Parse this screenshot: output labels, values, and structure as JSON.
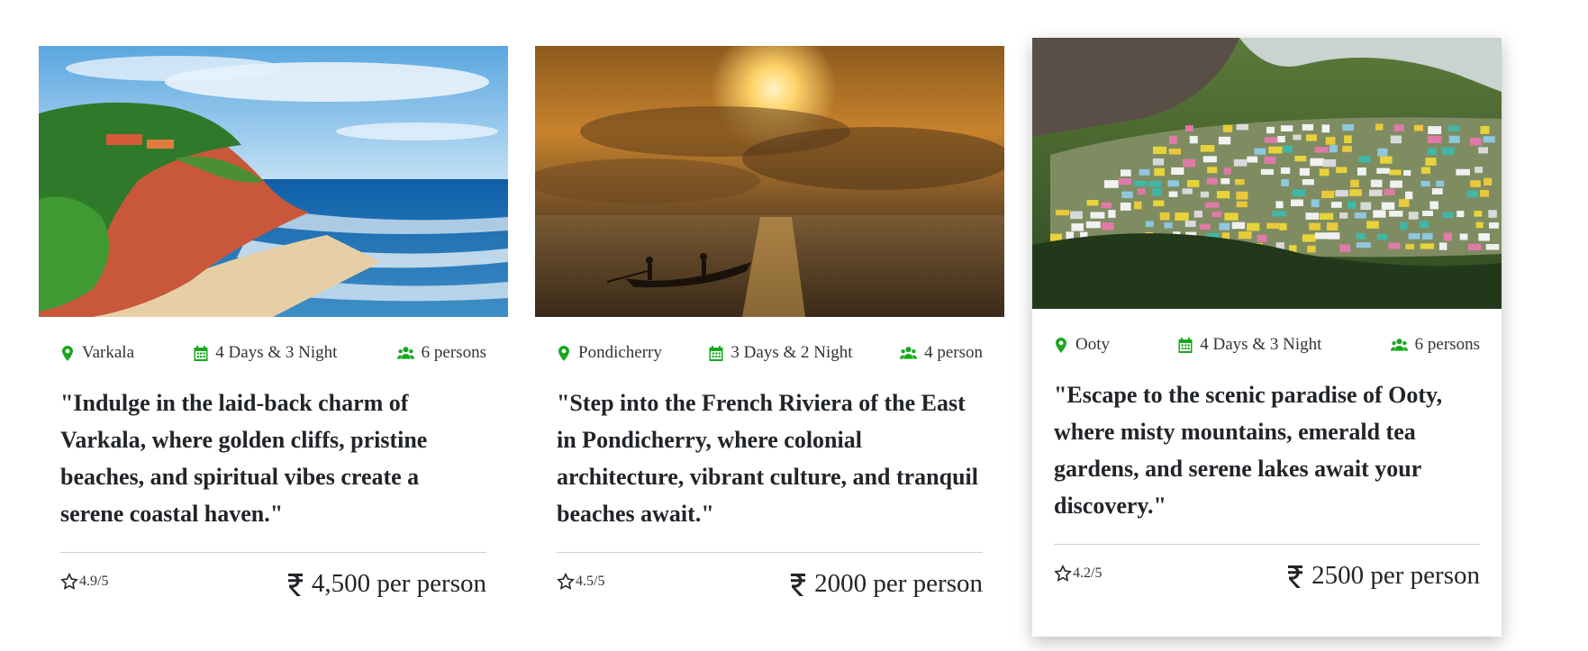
{
  "cards": [
    {
      "location": "Varkala",
      "duration": "4 Days & 3 Night",
      "persons": "6 persons",
      "description": "\"Indulge in the laid-back charm of Varkala, where golden cliffs, pristine beaches, and spiritual vibes create a serene coastal haven.\"",
      "rating": "4.9/5",
      "price": "4,500 per person"
    },
    {
      "location": "Pondicherry",
      "duration": "3 Days & 2 Night",
      "persons": "4 person",
      "description": "\"Step into the French Riviera of the East in Pondicherry, where colonial architecture, vibrant culture, and tranquil beaches await.\"",
      "rating": "4.5/5",
      "price": "2000 per person"
    },
    {
      "location": "Ooty",
      "duration": "4 Days & 3 Night",
      "persons": "6 persons",
      "description": "\"Escape to the scenic paradise of Ooty, where misty mountains, emerald tea gardens, and serene lakes await your discovery.\"",
      "rating": "4.2/5",
      "price": "2500 per person"
    }
  ],
  "colors": {
    "accent": "#17a81f",
    "text": "#212529",
    "divider": "#cfcfcf"
  },
  "icons": [
    "map-pin-icon",
    "calendar-icon",
    "users-icon",
    "star-outline-icon",
    "rupee-icon"
  ]
}
